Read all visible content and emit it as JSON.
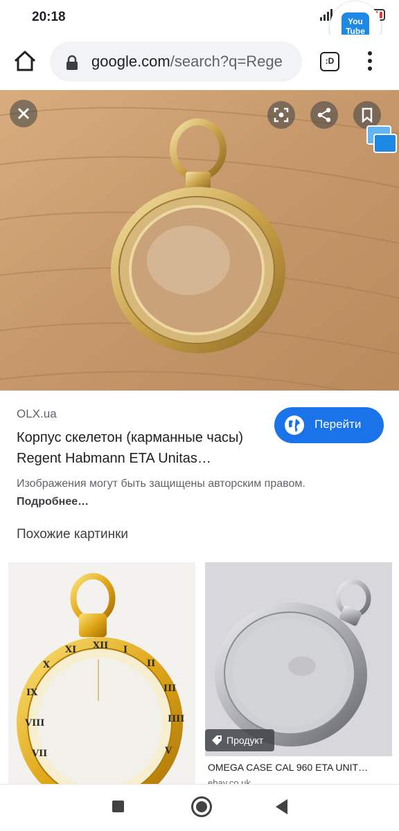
{
  "status_bar": {
    "time": "20:18",
    "battery": "17",
    "youtube_badge": "You Tube"
  },
  "browser": {
    "url_host": "google.com",
    "url_path": "/search?q=Rege",
    "tab_switcher": ":D"
  },
  "result": {
    "source": "OLX.ua",
    "title": "Корпус скелетон (карманные часы) Regent Habmann ETA Unitas…",
    "goto_label": "Перейти",
    "copyright_notice": "Изображения могут быть защищены авторским правом.",
    "more_link": "Подробнее…",
    "similar_heading": "Похожие картинки"
  },
  "similar": [
    {
      "chip": "Продукт",
      "caption": "OMEGA CASE CAL 960 ETA UNIT…",
      "site": "ebay.co.uk"
    }
  ],
  "icons": {
    "home": "home-icon",
    "lock": "lock-icon",
    "menu": "more-vert-icon",
    "close": "close-icon",
    "lens": "lens-icon",
    "share": "share-icon",
    "bookmark": "bookmark-icon",
    "globe": "globe-icon",
    "tag": "tag-icon"
  },
  "colors": {
    "accent": "#1a73e8",
    "text_primary": "#202124",
    "text_secondary": "#5f6368"
  }
}
